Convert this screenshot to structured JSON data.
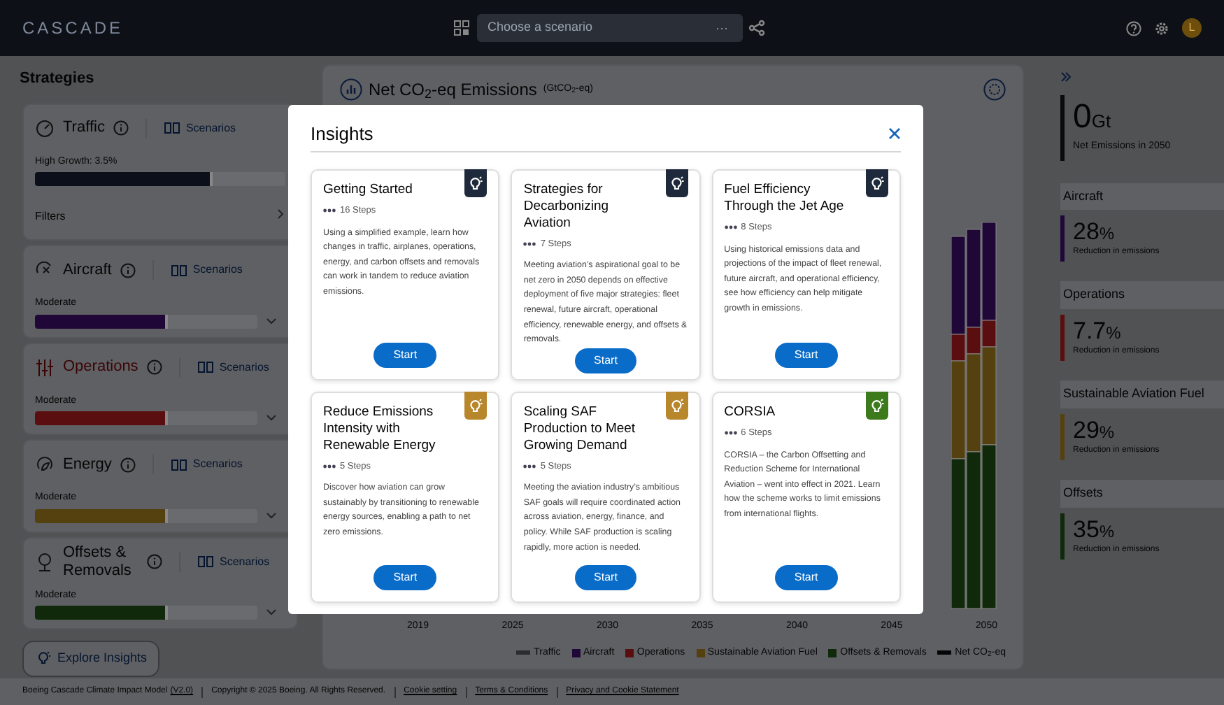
{
  "topbar": {
    "logo": "CASCADE",
    "scenario_field": {
      "placeholder": "Choose a scenario",
      "menu": "···"
    },
    "avatar": "L"
  },
  "strategies": {
    "title": "Strategies",
    "items": [
      {
        "kind": "traffic",
        "name": "Traffic",
        "alert": false,
        "link": "Scenarios",
        "setting": "High Growth: 3.5%",
        "level": 0.71,
        "color": "#0b0f1a",
        "filters": "Filters"
      },
      {
        "kind": "aircraft",
        "name": "Aircraft",
        "alert": false,
        "link": "Scenarios",
        "setting": "Moderate",
        "level": 0.6,
        "color": "#1f0738"
      },
      {
        "kind": "operations",
        "name": "Operations",
        "alert": true,
        "link": "Scenarios",
        "setting": "Moderate",
        "level": 0.6,
        "color": "#5a0e10"
      },
      {
        "kind": "energy",
        "name": "Energy",
        "alert": false,
        "link": "Scenarios",
        "setting": "Moderate",
        "level": 0.6,
        "color": "#55400f"
      },
      {
        "kind": "offsets",
        "name": "Offsets & Removals",
        "alert": false,
        "link": "Scenarios",
        "setting": "Moderate",
        "level": 0.6,
        "color": "#10290a"
      }
    ],
    "explore_button": "Explore Insights"
  },
  "chart": {
    "title": "Net CO$_{2}$-eq Emissions",
    "unit": "(GtCO$_{2}$-eq)",
    "x_labels": [
      "2019",
      "2025",
      "2030",
      "2035",
      "2040",
      "2045",
      "2050"
    ],
    "legend": [
      {
        "label": "Traffic",
        "kind": "line",
        "color": "#2a2c30"
      },
      {
        "label": "Aircraft",
        "kind": "square",
        "color": "#1f0738"
      },
      {
        "label": "Operations",
        "kind": "square",
        "color": "#5a0e10"
      },
      {
        "label": "Sustainable Aviation Fuel",
        "kind": "square",
        "color": "#55400f"
      },
      {
        "label": "Offsets & Removals",
        "kind": "square",
        "color": "#10290a"
      },
      {
        "label": "Net CO$_{2}$-eq",
        "kind": "line",
        "color": "#050505"
      }
    ]
  },
  "insights": {
    "title": "Insights",
    "cards": [
      {
        "title": "Getting Started",
        "steps": "16 Steps",
        "description": "Using a simplified example, learn how changes in traffic, airplanes, operations, energy, and carbon offsets and removals can work in tandem to reduce aviation emissions.",
        "button": "Start",
        "color": "#1e2a3b"
      },
      {
        "title": "Strategies for Decarbonizing Aviation",
        "steps": "7 Steps",
        "description": "Meeting aviation’s aspirational goal to be net zero in 2050 depends on effective deployment of five major strategies: fleet renewal, future aircraft, operational efficiency, renewable energy, and offsets & removals.",
        "button": "Start",
        "color": "#1e2a3b"
      },
      {
        "title": "Fuel Efficiency Through the Jet Age",
        "steps": "8 Steps",
        "description": "Using historical emissions data and projections of the impact of fleet renewal, future aircraft, and operational efficiency, see how efficiency can help mitigate growth in emissions.",
        "button": "Start",
        "color": "#1e2a3b"
      },
      {
        "title": "Reduce Emissions Intensity with Renewable Energy",
        "steps": "5 Steps",
        "description": "Discover how aviation can grow sustainably by transitioning to renewable energy sources, enabling a path to net zero emissions.",
        "button": "Start",
        "color": "#b8862b"
      },
      {
        "title": "Scaling SAF Production to Meet Growing Demand",
        "steps": "5 Steps",
        "description": "Meeting the aviation industry’s ambitious SAF goals will require coordinated action across aviation, energy, finance, and policy. While SAF production is scaling rapidly, more action is needed.",
        "button": "Start",
        "color": "#b8862b"
      },
      {
        "title": "CORSIA",
        "steps": "6 Steps",
        "description": "CORSIA – the Carbon Offsetting and Reduction Scheme for International Aviation – went into effect in 2021. Learn how the scheme works to limit emissions from international flights.",
        "button": "Start",
        "color": "#3c7a1c"
      }
    ]
  },
  "summary": {
    "total": {
      "value": "0",
      "unit": "Gt",
      "label": "Net Emissions in 2050"
    },
    "items": [
      {
        "name": "Aircraft",
        "value": "28",
        "unit": "%",
        "label": "Reduction in emissions",
        "color": "#1f0738"
      },
      {
        "name": "Operations",
        "value": "7.7",
        "unit": "%",
        "label": "Reduction in emissions",
        "color": "#5a0e10"
      },
      {
        "name": "Sustainable Aviation Fuel",
        "value": "29",
        "unit": "%",
        "label": "Reduction in emissions",
        "color": "#55400f"
      },
      {
        "name": "Offsets",
        "value": "35",
        "unit": "%",
        "label": "Reduction in emissions",
        "color": "#10290a"
      }
    ]
  },
  "footer": {
    "model": "Boeing Cascade Climate Impact Model",
    "version": "(V2.0)",
    "copyright": "Copyright © 2025 Boeing. All Rights Reserved.",
    "links": [
      "Cookie setting",
      "Terms & Conditions",
      "Privacy and Cookie Statement"
    ]
  }
}
